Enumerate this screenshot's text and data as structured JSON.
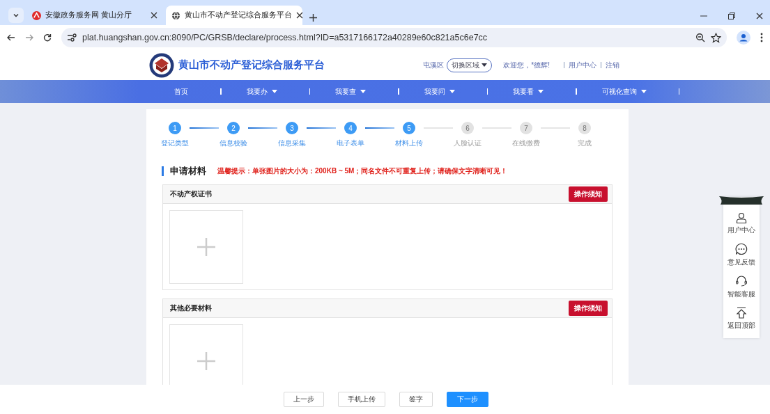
{
  "browser": {
    "tabs": [
      {
        "title": "安徽政务服务网 黄山分厅",
        "selected": false
      },
      {
        "title": "黄山市不动产登记综合服务平台",
        "selected": true
      }
    ],
    "url": "plat.huangshan.gov.cn:8090/PC/GRSB/declare/process.html?ID=a5317166172a40289e60c821a5c6e7cc"
  },
  "header": {
    "site_title": "黄山市不动产登记综合服务平台",
    "district": "屯溪区",
    "region_button": "切换区域",
    "welcome": "欢迎您，*德辉!",
    "links": [
      "用户中心",
      "注销"
    ]
  },
  "nav": [
    {
      "label": "首页",
      "dropdown": false
    },
    {
      "label": "我要办",
      "dropdown": true
    },
    {
      "label": "我要查",
      "dropdown": true
    },
    {
      "label": "我要问",
      "dropdown": true
    },
    {
      "label": "我要看",
      "dropdown": true
    },
    {
      "label": "可视化查询",
      "dropdown": true
    }
  ],
  "steps": [
    {
      "number": "1",
      "label": "登记类型",
      "done": true
    },
    {
      "number": "2",
      "label": "信息校验",
      "done": true
    },
    {
      "number": "3",
      "label": "信息采集",
      "done": true
    },
    {
      "number": "4",
      "label": "电子表单",
      "done": true
    },
    {
      "number": "5",
      "label": "材料上传",
      "done": true
    },
    {
      "number": "6",
      "label": "人脸认证",
      "done": false
    },
    {
      "number": "7",
      "label": "在线缴费",
      "done": false
    },
    {
      "number": "8",
      "label": "完成",
      "done": false
    }
  ],
  "section": {
    "title": "申请材料",
    "notice": "温馨提示：单张图片的大小为：200KB ~ 5M；同名文件不可重复上传；请确保文字清晰可见！"
  },
  "materials": [
    {
      "title": "不动产权证书",
      "button": "操作须知"
    },
    {
      "title": "其他必要材料",
      "button": "操作须知"
    }
  ],
  "side_panel": [
    {
      "kind": "user",
      "label": "用户中心"
    },
    {
      "kind": "chat",
      "label": "意见反馈"
    },
    {
      "kind": "headset",
      "label": "智能客服"
    },
    {
      "kind": "top",
      "label": "返回顶部"
    }
  ],
  "actions": [
    {
      "label": "上一步",
      "primary": false
    },
    {
      "label": "手机上传",
      "primary": false
    },
    {
      "label": "签字",
      "primary": false
    },
    {
      "label": "下一步",
      "primary": true
    }
  ]
}
